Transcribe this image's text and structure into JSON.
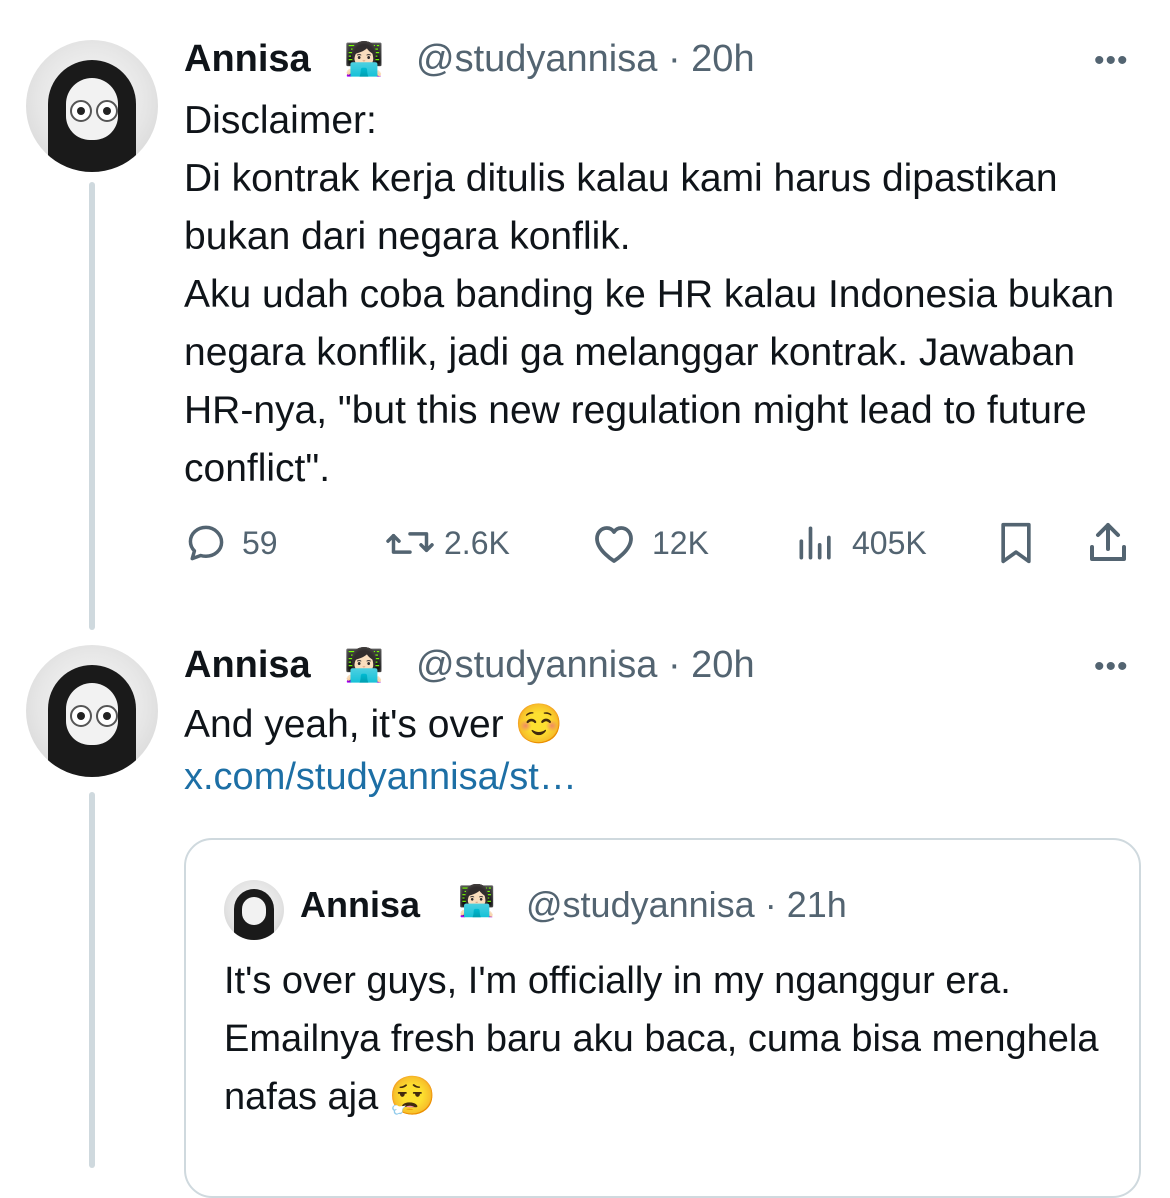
{
  "tweet1": {
    "name": "Annisa",
    "badge": "👩🏻‍💻",
    "handle": "@studyannisa",
    "time": "20h",
    "more": "•••",
    "text": "Disclaimer:\nDi kontrak kerja ditulis kalau kami harus dipastikan bukan dari negara konflik.\nAku udah coba banding ke HR kalau Indonesia bukan negara konflik, jadi ga melanggar kontrak. Jawaban HR-nya, \"but this new regulation might lead to future conflict\".",
    "actions": {
      "replies": "59",
      "reposts": "2.6K",
      "likes": "12K",
      "views": "405K"
    }
  },
  "tweet2": {
    "name": "Annisa",
    "badge": "👩🏻‍💻",
    "handle": "@studyannisa",
    "time": "20h",
    "more": "•••",
    "text": "And yeah, it's over ☺️",
    "link": "x.com/studyannisa/st…"
  },
  "quoted": {
    "name": "Annisa",
    "badge": "👩🏻‍💻",
    "handle": "@studyannisa",
    "time": "21h",
    "text": "It's over guys, I'm officially in my nganggur era. Emailnya fresh baru aku baca, cuma bisa menghela nafas aja 😮‍💨"
  },
  "colors": {
    "text": "#0f1419",
    "secondary": "#536471",
    "link": "#1d6fa5",
    "border": "#cfd9de"
  }
}
